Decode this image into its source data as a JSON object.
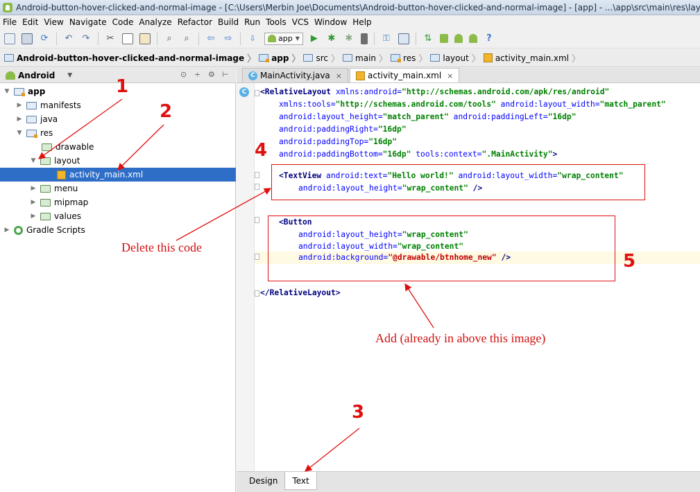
{
  "window": {
    "title": "Android-button-hover-clicked-and-normal-image - [C:\\Users\\Merbin Joe\\Documents\\Android-button-hover-clicked-and-normal-image] - [app] - ...\\app\\src\\main\\res\\layout\\activity_mai"
  },
  "menu": [
    "File",
    "Edit",
    "View",
    "Navigate",
    "Code",
    "Analyze",
    "Refactor",
    "Build",
    "Run",
    "Tools",
    "VCS",
    "Window",
    "Help"
  ],
  "toolbar": {
    "run_config": "app",
    "help": "?"
  },
  "breadcrumb": [
    "Android-button-hover-clicked-and-normal-image",
    "app",
    "src",
    "main",
    "res",
    "layout",
    "activity_main.xml"
  ],
  "project_panel": {
    "view_label": "Android",
    "tree": [
      {
        "label": "app",
        "depth": 0,
        "expanded": true,
        "kind": "module"
      },
      {
        "label": "manifests",
        "depth": 1,
        "expanded": false,
        "kind": "folder"
      },
      {
        "label": "java",
        "depth": 1,
        "expanded": false,
        "kind": "folder"
      },
      {
        "label": "res",
        "depth": 1,
        "expanded": true,
        "kind": "res"
      },
      {
        "label": "drawable",
        "depth": 2,
        "expanded": null,
        "kind": "folder"
      },
      {
        "label": "layout",
        "depth": 2,
        "expanded": true,
        "kind": "folder"
      },
      {
        "label": "activity_main.xml",
        "depth": 3,
        "expanded": null,
        "kind": "xml",
        "selected": true
      },
      {
        "label": "menu",
        "depth": 2,
        "expanded": false,
        "kind": "folder"
      },
      {
        "label": "mipmap",
        "depth": 2,
        "expanded": false,
        "kind": "folder"
      },
      {
        "label": "values",
        "depth": 2,
        "expanded": false,
        "kind": "folder"
      },
      {
        "label": "Gradle Scripts",
        "depth": 0,
        "expanded": false,
        "kind": "gradle"
      }
    ]
  },
  "editor_tabs": [
    {
      "label": "MainActivity.java",
      "icon": "c-icon",
      "active": false
    },
    {
      "label": "activity_main.xml",
      "icon": "xml-icon",
      "active": true
    }
  ],
  "code": {
    "gutter_icon": "C",
    "l1": {
      "open": "<RelativeLayout",
      "a1": " xmlns:android=",
      "v1": "\"http://schemas.android.com/apk/res/android\""
    },
    "l2": {
      "a1": "xmlns:tools=",
      "v1": "\"http://schemas.android.com/tools\"",
      "a2": " android:layout_width=",
      "v2": "\"match_parent\""
    },
    "l3": {
      "a1": "android:layout_height=",
      "v1": "\"match_parent\"",
      "a2": " android:paddingLeft=",
      "v2": "\"16dp\""
    },
    "l4": {
      "a1": "android:paddingRight=",
      "v1": "\"16dp\""
    },
    "l5": {
      "a1": "android:paddingTop=",
      "v1": "\"16dp\""
    },
    "l6": {
      "a1": "android:paddingBottom=",
      "v1": "\"16dp\"",
      "a2": " tools:context=",
      "v2": "\".MainActivity\"",
      "close": ">"
    },
    "l7": {
      "open": "<TextView",
      "a1": " android:text=",
      "v1": "\"Hello world!\"",
      "a2": " android:layout_width=",
      "v2": "\"wrap_content\""
    },
    "l8": {
      "a1": "android:layout_height=",
      "v1": "\"wrap_content\"",
      "close": " />"
    },
    "l9": {
      "open": "<Button"
    },
    "l10": {
      "a1": "android:layout_height=",
      "v1": "\"wrap_content\""
    },
    "l11": {
      "a1": "android:layout_width=",
      "v1": "\"wrap_content\""
    },
    "l12": {
      "a1": "android:background=",
      "v1": "\"@drawable/btnhome_new\"",
      "close": " />"
    },
    "l13": {
      "close": "</RelativeLayout>"
    }
  },
  "bottom_tabs": [
    {
      "label": "Design",
      "active": false
    },
    {
      "label": "Text",
      "active": true
    }
  ],
  "annotations": {
    "n1": "1",
    "n2": "2",
    "n3": "3",
    "n4": "4",
    "n5": "5",
    "delete_text": "Delete this code",
    "add_text": "Add (already in above this image)",
    "color": "#e01010"
  }
}
